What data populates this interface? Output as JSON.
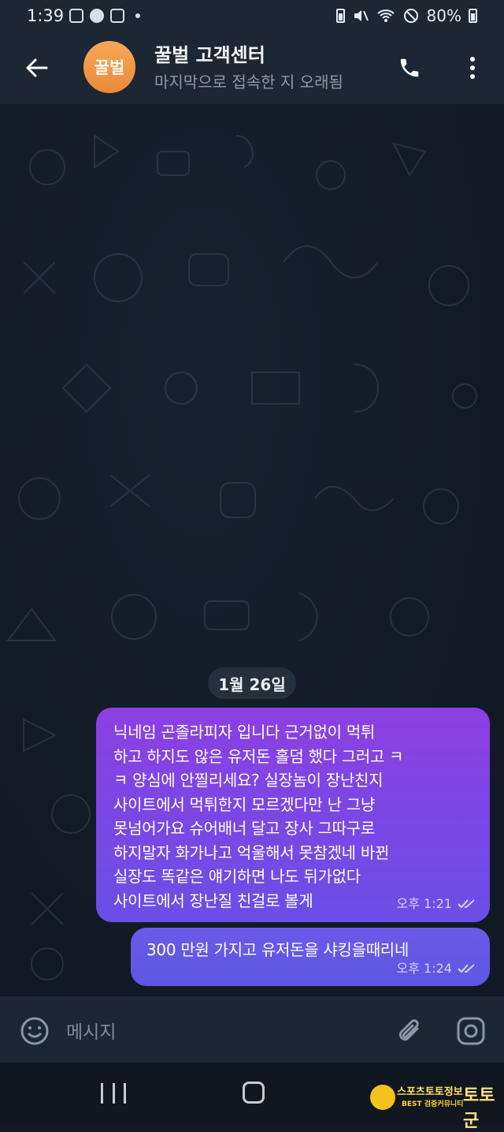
{
  "status_bar": {
    "time": "1:39",
    "battery": "80%"
  },
  "header": {
    "avatar_text": "꿀벌",
    "title": "꿀벌 고객센터",
    "subtitle": "마지막으로 접속한 지 오래됨"
  },
  "chat": {
    "date_separator": "1월 26일",
    "messages": [
      {
        "text": "닉네임 곤졸라피자 입니다 근거없이 먹튀\n하고 하지도 않은 유저돈 홀덤 했다 그러고 ㅋ\nㅋ 양심에 안찔리세요? 실장놈이 장난친지\n사이트에서 먹튀한지 모르겠다만 난 그냥\n못넘어가요 슈어배너 달고 장사 그따구로\n하지말자 화가나고 억울해서 못참겠네 바뀐\n실장도 똑같은 얘기하면 나도 뒤가없다\n사이트에서 장난질 친걸로 볼게",
        "time": "오후 1:21",
        "status": "read"
      },
      {
        "text": "300 만원 가지고 유저돈을 샤킹을때리네",
        "time": "오후 1:24",
        "status": "read"
      }
    ]
  },
  "input": {
    "placeholder": "메시지"
  },
  "watermark": {
    "line1": "스포츠토토정보",
    "line2": "BEST 검증커뮤니티",
    "brand": "토토군"
  },
  "colors": {
    "bubble_top": "#8c3fe2",
    "bubble_bottom": "#6a4fe6",
    "header_bg": "#1d2733",
    "avatar": "#f0964a"
  }
}
